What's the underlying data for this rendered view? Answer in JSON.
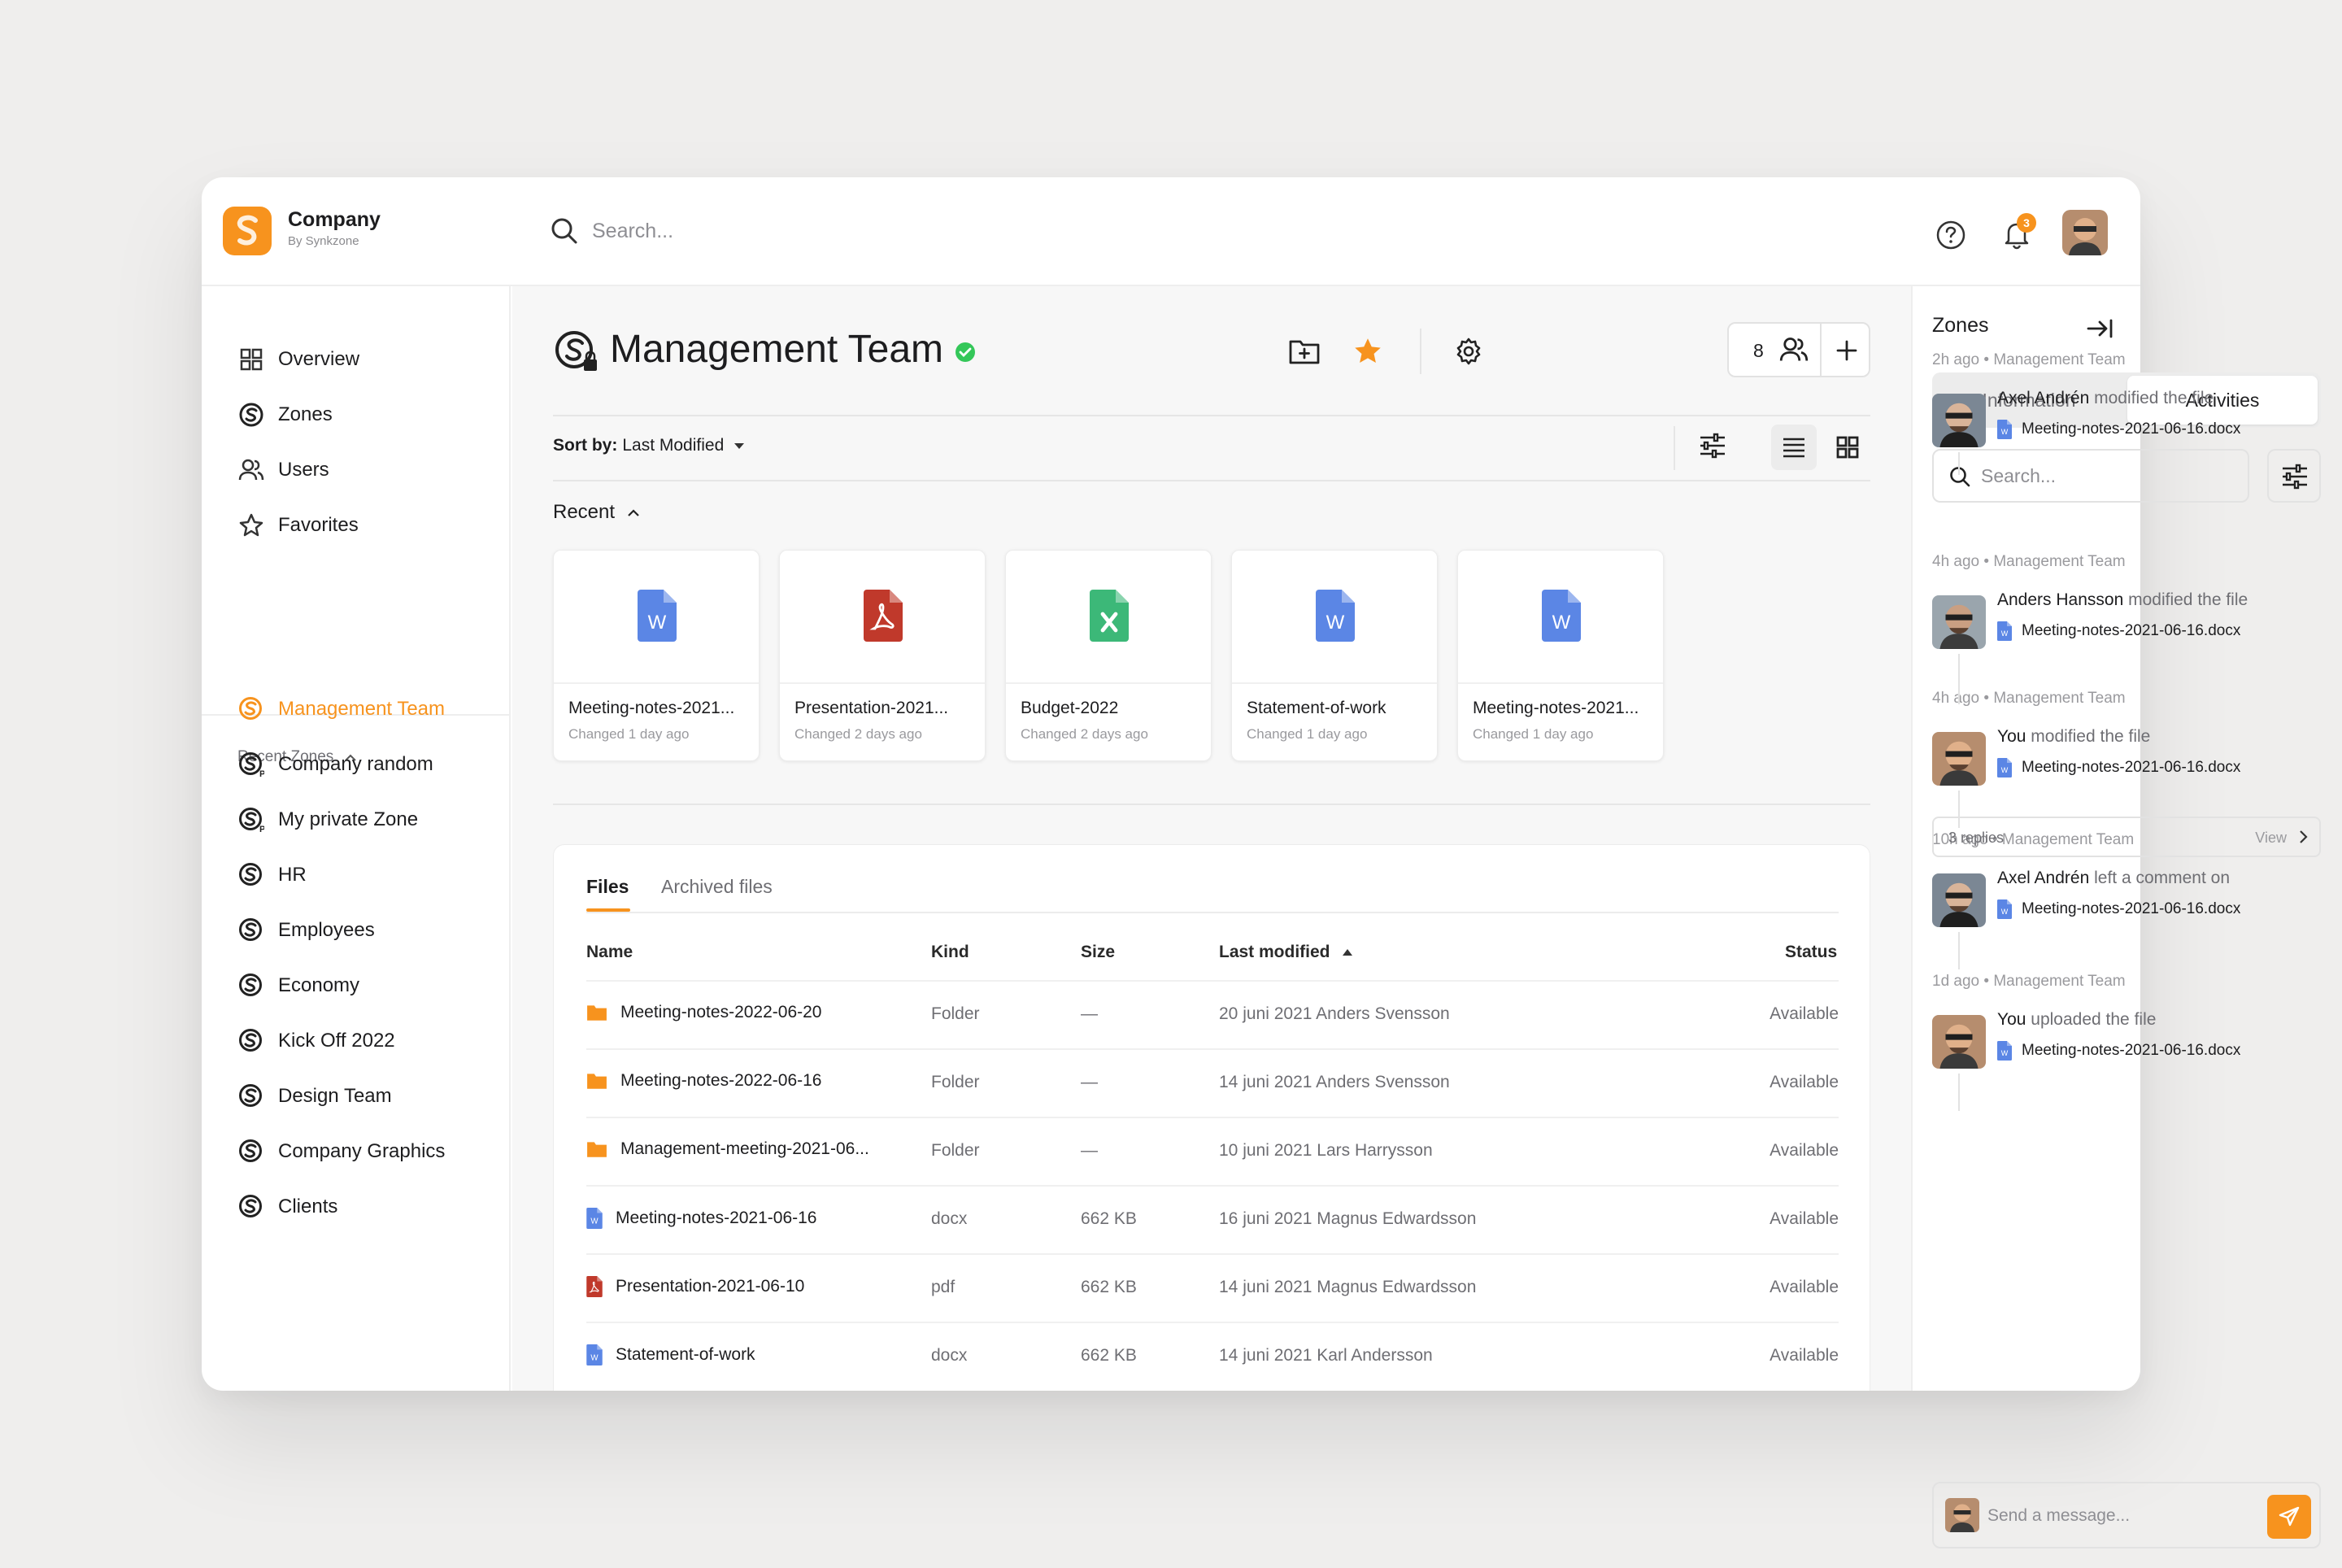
{
  "colors": {
    "accent": "#f7931e",
    "success": "#34c759",
    "word": "#5b86e5",
    "pdf": "#c0392b",
    "excel": "#3cb878"
  },
  "brand": {
    "name": "Company",
    "sub": "By Synkzone"
  },
  "header": {
    "search_placeholder": "Search...",
    "notification_count": "3"
  },
  "sidebar": {
    "nav": [
      {
        "label": "Overview",
        "icon": "grid-icon"
      },
      {
        "label": "Zones",
        "icon": "zone-icon"
      },
      {
        "label": "Users",
        "icon": "users-icon"
      },
      {
        "label": "Favorites",
        "icon": "star-icon"
      }
    ],
    "recent_zones_label": "Recent Zones",
    "zones": [
      {
        "label": "Management Team",
        "active": true
      },
      {
        "label": "Company random"
      },
      {
        "label": "My private Zone"
      },
      {
        "label": "HR"
      },
      {
        "label": "Employees"
      },
      {
        "label": "Economy"
      },
      {
        "label": "Kick Off 2022"
      },
      {
        "label": "Design Team"
      },
      {
        "label": "Company Graphics"
      },
      {
        "label": "Clients"
      }
    ]
  },
  "main": {
    "title": "Management Team",
    "members_count": "8",
    "sort_prefix": "Sort by:",
    "sort_value": "Last Modified",
    "recent_label": "Recent",
    "recent_cards": [
      {
        "name": "Meeting-notes-2021...",
        "changed": "Changed 1 day ago",
        "type": "word"
      },
      {
        "name": "Presentation-2021...",
        "changed": "Changed 2 days ago",
        "type": "pdf"
      },
      {
        "name": "Budget-2022",
        "changed": "Changed 2 days ago",
        "type": "excel"
      },
      {
        "name": "Statement-of-work",
        "changed": "Changed 1 day ago",
        "type": "word"
      },
      {
        "name": "Meeting-notes-2021...",
        "changed": "Changed 1 day ago",
        "type": "word"
      }
    ],
    "tabs": [
      "Files",
      "Archived files"
    ],
    "columns": [
      "Name",
      "Kind",
      "Size",
      "Last modified",
      "Status"
    ],
    "rows": [
      {
        "name": "Meeting-notes-2022-06-20",
        "kind": "Folder",
        "size": "—",
        "modified": "20 juni 2021 Anders Svensson",
        "status": "Available",
        "type": "folder"
      },
      {
        "name": "Meeting-notes-2022-06-16",
        "kind": "Folder",
        "size": "—",
        "modified": "14 juni 2021 Anders Svensson",
        "status": "Available",
        "type": "folder"
      },
      {
        "name": "Management-meeting-2021-06...",
        "kind": "Folder",
        "size": "—",
        "modified": "10 juni 2021 Lars Harrysson",
        "status": "Available",
        "type": "folder"
      },
      {
        "name": "Meeting-notes-2021-06-16",
        "kind": "docx",
        "size": "662 KB",
        "modified": "16 juni 2021 Magnus Edwardsson",
        "status": "Available",
        "type": "word"
      },
      {
        "name": "Presentation-2021-06-10",
        "kind": "pdf",
        "size": "662 KB",
        "modified": "14 juni 2021 Magnus Edwardsson",
        "status": "Available",
        "type": "pdf"
      },
      {
        "name": "Statement-of-work",
        "kind": "docx",
        "size": "662 KB",
        "modified": "14 juni 2021 Karl Andersson",
        "status": "Available",
        "type": "word"
      }
    ]
  },
  "right": {
    "title": "Zones",
    "seg_info": "Information",
    "seg_activities": "Activities",
    "search_placeholder": "Search...",
    "activities": [
      {
        "meta": "2h ago • Management Team",
        "user": "Axel Andrén",
        "action": "modified the file",
        "file": "Meeting-notes-2021-06-16.docx",
        "avatar": "a"
      },
      {
        "meta": "4h ago • Management Team",
        "user": "Anders Hansson",
        "action": "modified the file",
        "file": "Meeting-notes-2021-06-16.docx",
        "avatar": "b"
      },
      {
        "meta": "4h ago • Management Team",
        "user": "You",
        "action": "modified the file",
        "file": "Meeting-notes-2021-06-16.docx",
        "avatar": "c"
      },
      {
        "meta": "10h ago • Management Team",
        "user": "Axel Andrén",
        "action": "left a comment on",
        "file": "Meeting-notes-2021-06-16.docx",
        "avatar": "a"
      },
      {
        "meta": "1d ago • Management Team",
        "user": "You",
        "action": "uploaded the file",
        "file": "Meeting-notes-2021-06-16.docx",
        "avatar": "c"
      }
    ],
    "replies_label": "3 replies",
    "replies_view": "View",
    "message_placeholder": "Send a message..."
  }
}
